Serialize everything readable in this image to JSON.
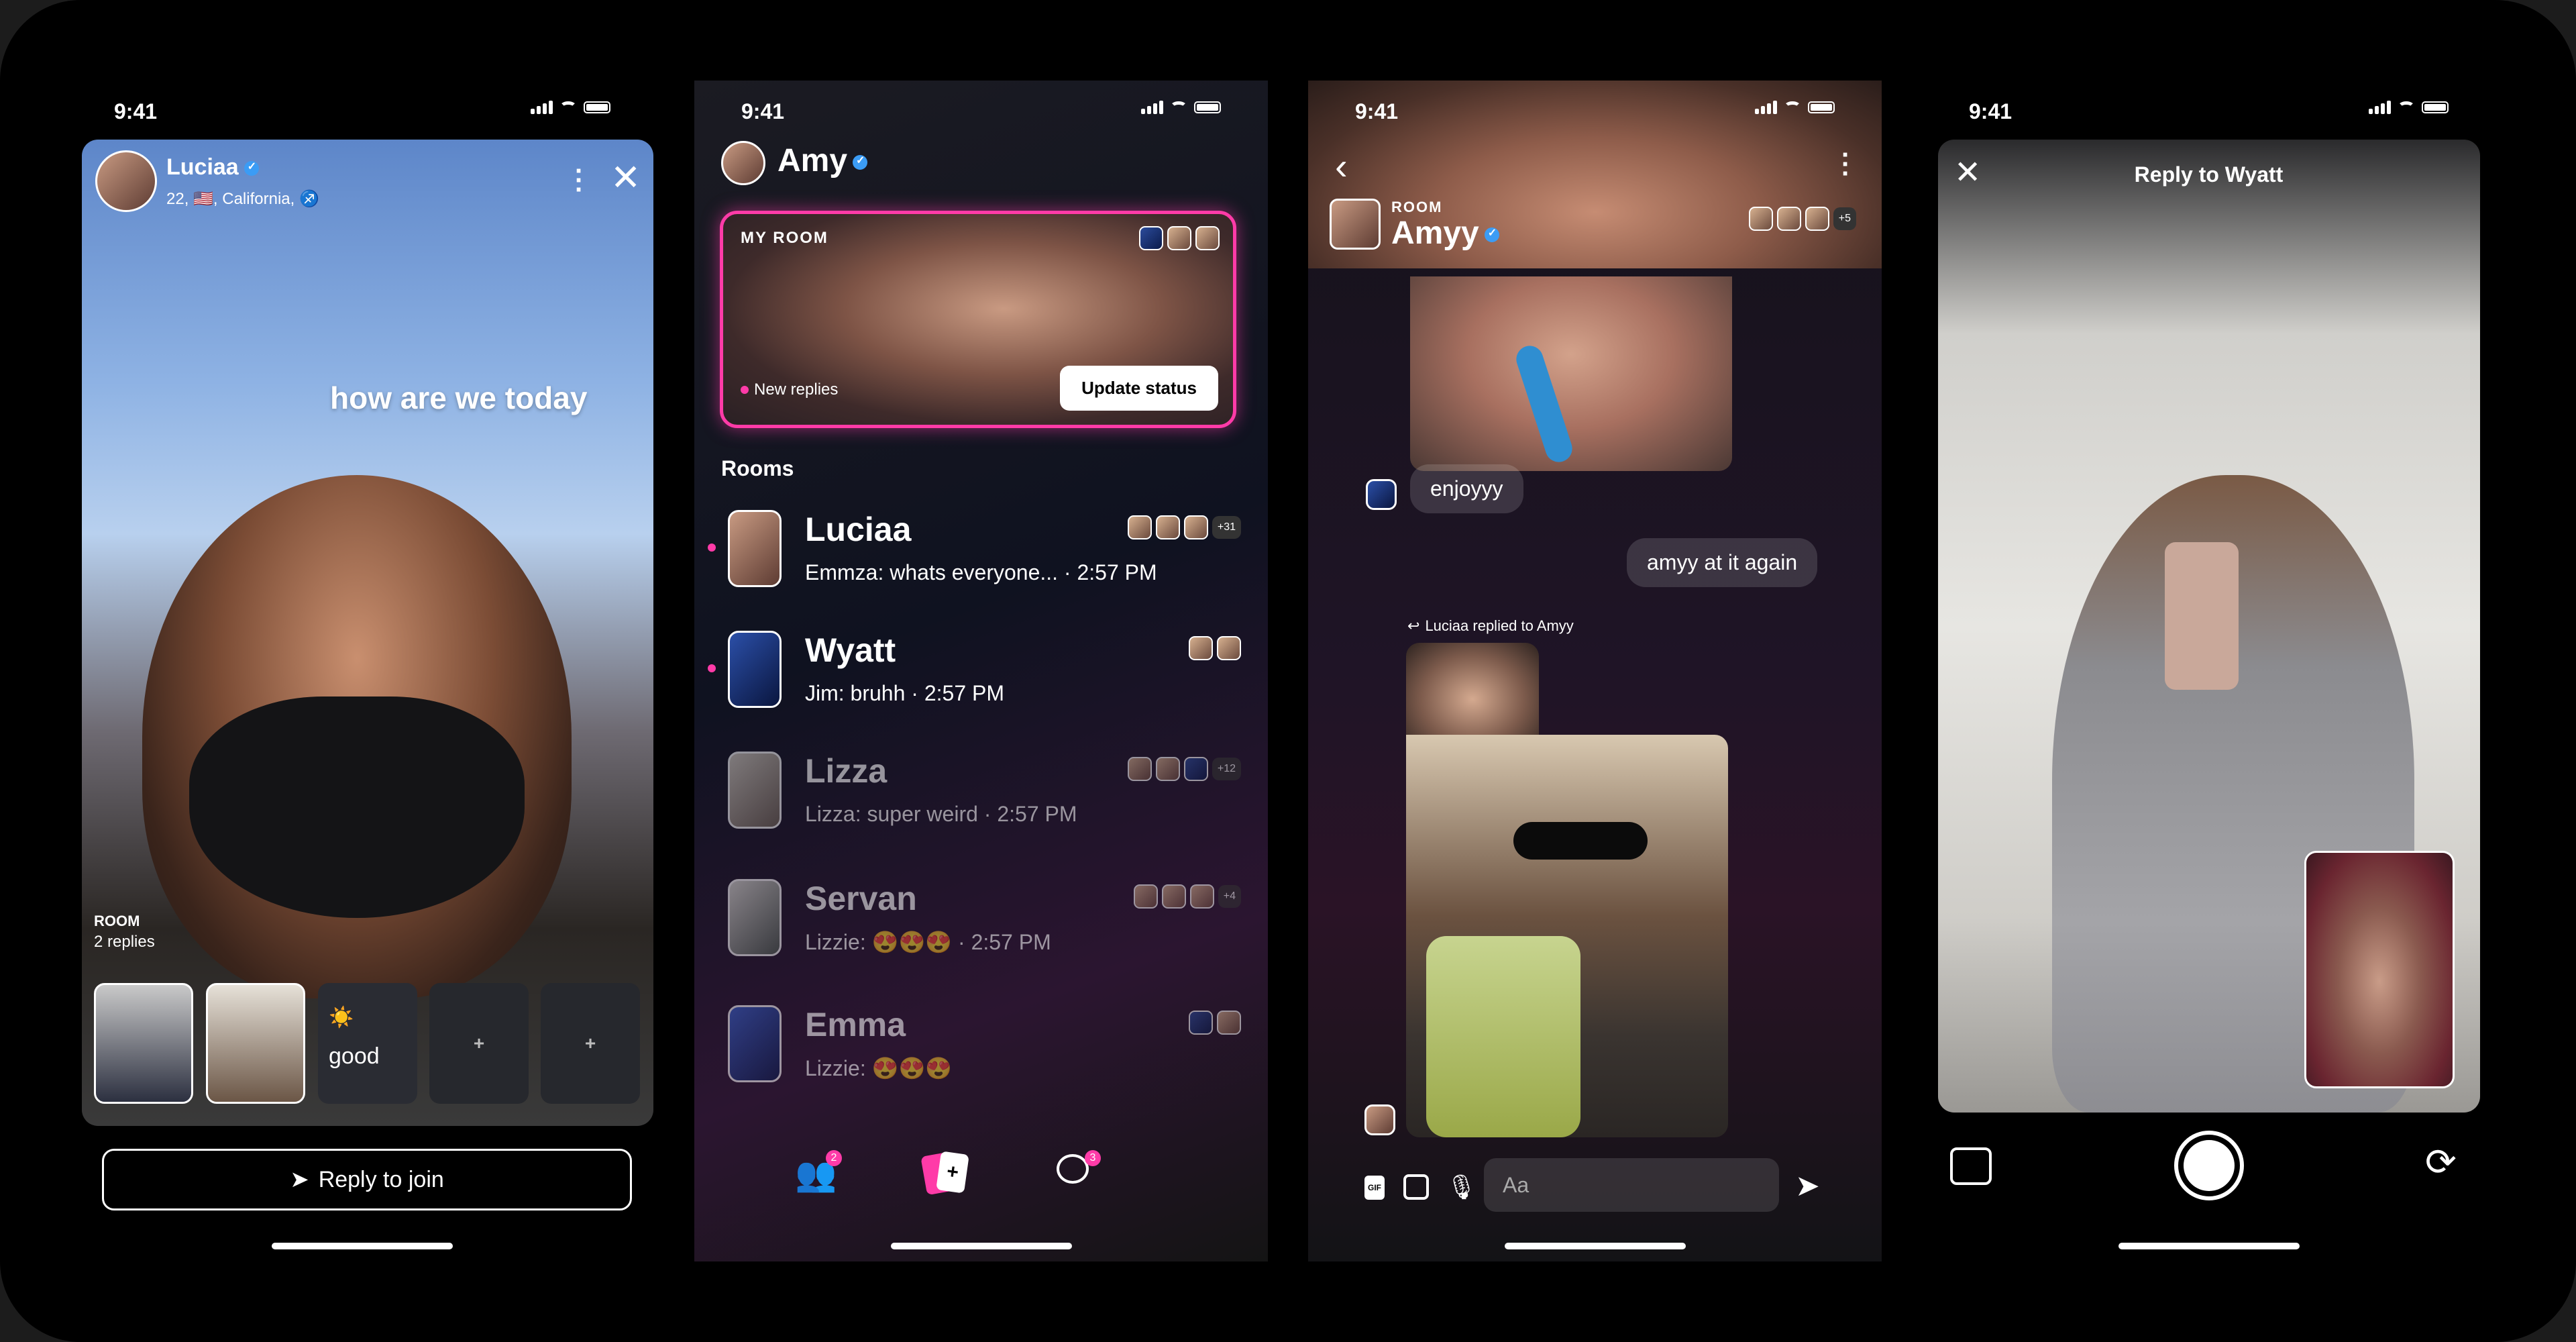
{
  "status_time": "9:41",
  "screen1": {
    "user_name": "Luciaa",
    "user_meta": "22, 🇺🇸, California, ♐",
    "caption": "how are we today",
    "room_label": "ROOM",
    "replies_label": "2 replies",
    "status_tile_emoji": "☀️",
    "status_tile_text": "good",
    "add_slot_1": "+",
    "add_slot_2": "+",
    "reply_button": "Reply to join"
  },
  "screen2": {
    "header_name": "Amy",
    "my_room_label": "MY ROOM",
    "new_replies": "New replies",
    "update_status": "Update status",
    "rooms_header": "Rooms",
    "rooms": [
      {
        "name": "Luciaa",
        "sub": "Emmza: whats everyone... · 2:57 PM",
        "extra": "+31",
        "unread": true
      },
      {
        "name": "Wyatt",
        "sub": "Jim: bruhh · 2:57 PM",
        "extra": "",
        "unread": true
      },
      {
        "name": "Lizza",
        "sub": "Lizza: super weird · 2:57 PM",
        "extra": "+12",
        "unread": false
      },
      {
        "name": "Servan",
        "sub": "Lizzie: 😍😍😍 · 2:57 PM",
        "extra": "+4",
        "unread": false
      },
      {
        "name": "Emma",
        "sub": "Lizzie: 😍😍😍",
        "extra": "",
        "unread": false
      }
    ],
    "tab_friends_badge": "2",
    "tab_chat_badge": "3"
  },
  "screen3": {
    "room_label": "ROOM",
    "room_name": "Amyy",
    "room_extra": "+5",
    "msg_1": "enjoyyy",
    "msg_2": "amyy at it again",
    "reply_note": "Luciaa replied to Amyy",
    "input_placeholder": "Aa",
    "gif_label": "GIF"
  },
  "screen4": {
    "title": "Reply to Wyatt"
  },
  "colors": {
    "accent_pink": "#ff3ba8",
    "verified_blue": "#3b9cf5"
  }
}
